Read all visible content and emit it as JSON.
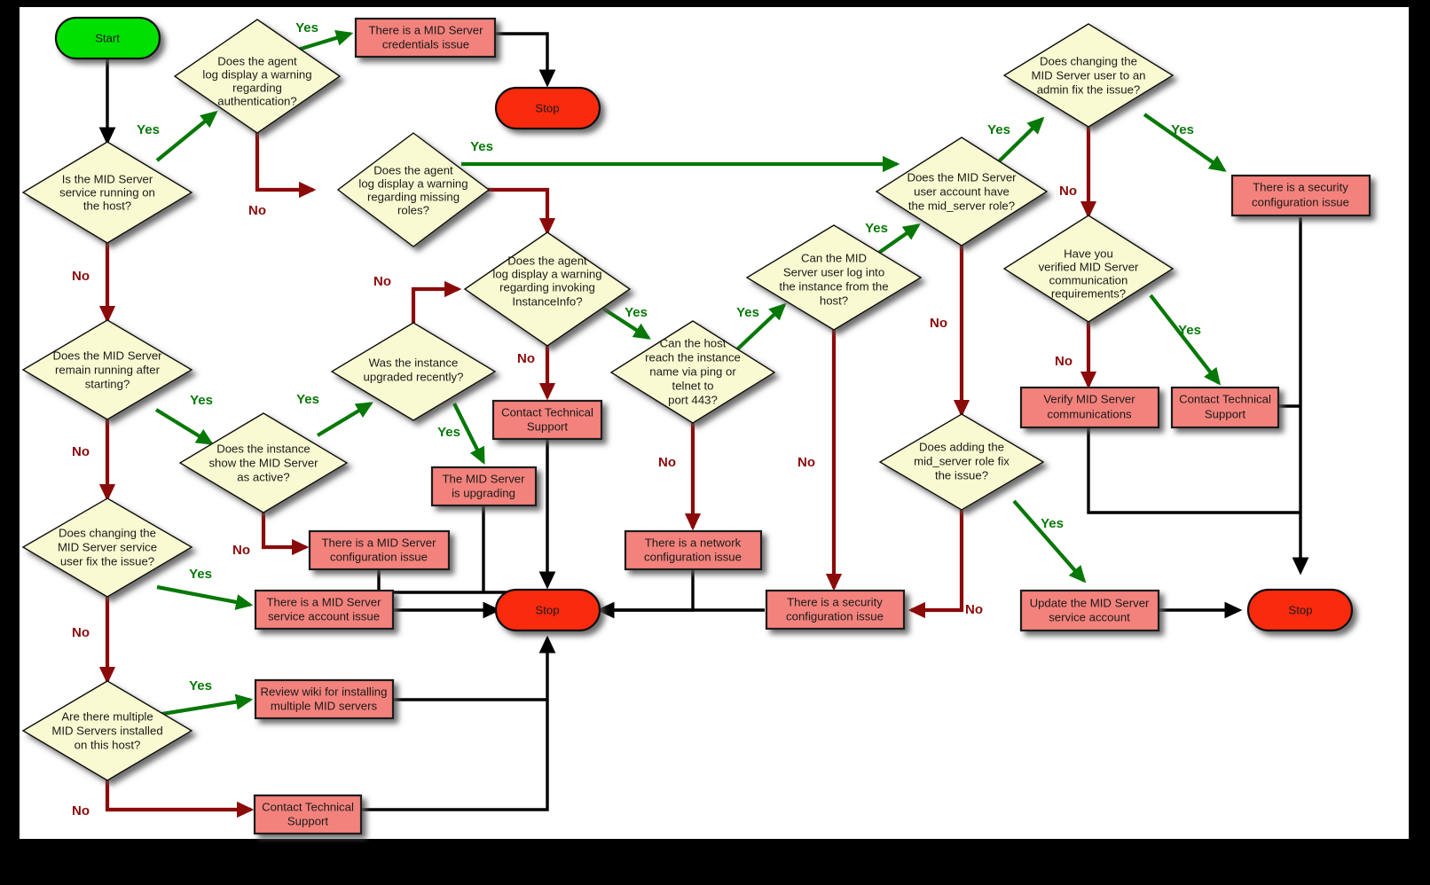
{
  "diagram": {
    "title": "MID Server troubleshooting flowchart",
    "colors": {
      "background": "#000000",
      "canvas": "#FFFFFF",
      "decision_fill": "#FAFAD2",
      "action_fill": "#F4827B",
      "start_fill": "#00E000",
      "stop_fill": "#FA2A0A",
      "yes_edge": "#067806",
      "no_edge": "#8B0A0A",
      "plain_edge": "#000000"
    }
  },
  "nodes": {
    "start": {
      "label": "Start",
      "type": "terminator"
    },
    "d_service_running": {
      "label": "Is the MID Server\nservice running on\nthe host?",
      "type": "decision"
    },
    "d_auth_warning": {
      "label": "Does the agent\nlog display a warning\nregarding\nauthentication?",
      "type": "decision"
    },
    "a_credentials_issue": {
      "label": "There is a MID Server\ncredentials issue",
      "type": "action"
    },
    "stop_top": {
      "label": "Stop",
      "type": "terminator"
    },
    "d_missing_roles": {
      "label": "Does the agent\nlog display a warning\nregarding missing\nroles?",
      "type": "decision"
    },
    "d_instanceinfo": {
      "label": "Does the agent\nlog display a warning\nregarding invoking\nInstanceInfo?",
      "type": "decision"
    },
    "d_remain_running": {
      "label": "Does the MID Server\nremain running after\nstarting?",
      "type": "decision"
    },
    "d_instance_active": {
      "label": "Does the instance\nshow the MID Server\nas active?",
      "type": "decision"
    },
    "d_upgraded_recently": {
      "label": "Was the instance\nupgraded recently?",
      "type": "decision"
    },
    "a_contact_support_mid": {
      "label": "Contact Technical\nSupport",
      "type": "action"
    },
    "a_mid_upgrading": {
      "label": "The MID Server\nis upgrading",
      "type": "action"
    },
    "a_mid_config_issue": {
      "label": "There is a MID Server\nconfiguration issue",
      "type": "action"
    },
    "d_change_service_user": {
      "label": "Does changing the\nMID Server service\nuser fix the issue?",
      "type": "decision"
    },
    "a_service_account_issue": {
      "label": "There is a MID Server\nservice account issue",
      "type": "action"
    },
    "d_multiple_mid": {
      "label": "Are there multiple\nMID Servers installed\non this host?",
      "type": "decision"
    },
    "a_review_wiki": {
      "label": "Review wiki for installing\nmultiple MID servers",
      "type": "action"
    },
    "a_contact_support_bottom": {
      "label": "Contact Technical\nSupport",
      "type": "action"
    },
    "stop_center": {
      "label": "Stop",
      "type": "terminator"
    },
    "d_host_reach": {
      "label": "Can the host\nreach the instance\nname via ping or\ntelnet to\nport 443?",
      "type": "decision"
    },
    "a_network_config_issue": {
      "label": "There is a network\nconfiguration issue",
      "type": "action"
    },
    "d_user_login": {
      "label": "Can the MID\nServer user log into\nthe instance from the\nhost?",
      "type": "decision"
    },
    "a_security_config_center": {
      "label": "There is a security\nconfiguration issue",
      "type": "action"
    },
    "d_mid_server_role": {
      "label": "Does the MID Server\nuser account have\nthe mid_server role?",
      "type": "decision"
    },
    "d_change_to_admin": {
      "label": "Does changing the\nMID Server user to an\nadmin fix the issue?",
      "type": "decision"
    },
    "a_security_config_right": {
      "label": "There is a security\nconfiguration issue",
      "type": "action"
    },
    "d_verified_comms": {
      "label": "Have you\nverified MID Server\ncommunication\nrequirements?",
      "type": "decision"
    },
    "a_verify_comms": {
      "label": "Verify MID Server\ncommunications",
      "type": "action"
    },
    "a_contact_support_right": {
      "label": "Contact Technical\nSupport",
      "type": "action"
    },
    "d_adding_role": {
      "label": "Does adding the\nmid_server role fix\nthe issue?",
      "type": "decision"
    },
    "a_update_service_account": {
      "label": "Update the MID Server\nservice account",
      "type": "action"
    },
    "stop_right": {
      "label": "Stop",
      "type": "terminator"
    }
  },
  "edge_labels": {
    "yes": "Yes",
    "no": "No"
  },
  "edges": [
    {
      "from": "start",
      "to": "d_service_running",
      "label": "",
      "kind": "plain"
    },
    {
      "from": "d_service_running",
      "to": "d_auth_warning",
      "label": "Yes",
      "kind": "yes"
    },
    {
      "from": "d_service_running",
      "to": "d_remain_running",
      "label": "No",
      "kind": "no"
    },
    {
      "from": "d_auth_warning",
      "to": "a_credentials_issue",
      "label": "Yes",
      "kind": "yes"
    },
    {
      "from": "d_auth_warning",
      "to": "d_missing_roles",
      "label": "No",
      "kind": "no"
    },
    {
      "from": "a_credentials_issue",
      "to": "stop_top",
      "label": "",
      "kind": "plain"
    },
    {
      "from": "d_missing_roles",
      "to": "d_mid_server_role",
      "label": "Yes",
      "kind": "yes"
    },
    {
      "from": "d_missing_roles",
      "to": "d_instanceinfo",
      "label": "No",
      "kind": "no"
    },
    {
      "from": "d_instanceinfo",
      "to": "d_host_reach",
      "label": "Yes",
      "kind": "yes"
    },
    {
      "from": "d_instanceinfo",
      "to": "a_contact_support_mid",
      "label": "No",
      "kind": "no"
    },
    {
      "from": "d_upgraded_recently",
      "to": "d_instanceinfo",
      "label": "No",
      "kind": "no"
    },
    {
      "from": "d_upgraded_recently",
      "to": "a_mid_upgrading",
      "label": "Yes",
      "kind": "yes"
    },
    {
      "from": "d_remain_running",
      "to": "d_instance_active",
      "label": "Yes",
      "kind": "yes"
    },
    {
      "from": "d_remain_running",
      "to": "d_change_service_user",
      "label": "No",
      "kind": "no"
    },
    {
      "from": "d_instance_active",
      "to": "d_upgraded_recently",
      "label": "Yes",
      "kind": "yes"
    },
    {
      "from": "d_instance_active",
      "to": "a_mid_config_issue",
      "label": "No",
      "kind": "no"
    },
    {
      "from": "d_change_service_user",
      "to": "a_service_account_issue",
      "label": "Yes",
      "kind": "yes"
    },
    {
      "from": "d_change_service_user",
      "to": "d_multiple_mid",
      "label": "No",
      "kind": "no"
    },
    {
      "from": "d_multiple_mid",
      "to": "a_review_wiki",
      "label": "Yes",
      "kind": "yes"
    },
    {
      "from": "d_multiple_mid",
      "to": "a_contact_support_bottom",
      "label": "No",
      "kind": "no"
    },
    {
      "from": "d_host_reach",
      "to": "d_user_login",
      "label": "Yes",
      "kind": "yes"
    },
    {
      "from": "d_host_reach",
      "to": "a_network_config_issue",
      "label": "No",
      "kind": "no"
    },
    {
      "from": "d_user_login",
      "to": "d_mid_server_role",
      "label": "Yes",
      "kind": "yes"
    },
    {
      "from": "d_user_login",
      "to": "a_security_config_center",
      "label": "No",
      "kind": "no"
    },
    {
      "from": "d_mid_server_role",
      "to": "d_change_to_admin",
      "label": "Yes",
      "kind": "yes"
    },
    {
      "from": "d_mid_server_role",
      "to": "d_adding_role",
      "label": "No",
      "kind": "no"
    },
    {
      "from": "d_change_to_admin",
      "to": "a_security_config_right",
      "label": "Yes",
      "kind": "yes"
    },
    {
      "from": "d_change_to_admin",
      "to": "d_verified_comms",
      "label": "No",
      "kind": "no"
    },
    {
      "from": "d_verified_comms",
      "to": "a_contact_support_right",
      "label": "Yes",
      "kind": "yes"
    },
    {
      "from": "d_verified_comms",
      "to": "a_verify_comms",
      "label": "No",
      "kind": "no"
    },
    {
      "from": "d_adding_role",
      "to": "a_update_service_account",
      "label": "Yes",
      "kind": "yes"
    },
    {
      "from": "d_adding_role",
      "to": "a_security_config_center",
      "label": "No",
      "kind": "no"
    },
    {
      "from": "a_mid_config_issue",
      "to": "stop_center",
      "label": "",
      "kind": "plain"
    },
    {
      "from": "a_mid_upgrading",
      "to": "stop_center",
      "label": "",
      "kind": "plain"
    },
    {
      "from": "a_contact_support_mid",
      "to": "stop_center",
      "label": "",
      "kind": "plain"
    },
    {
      "from": "a_service_account_issue",
      "to": "stop_center",
      "label": "",
      "kind": "plain"
    },
    {
      "from": "a_review_wiki",
      "to": "stop_center",
      "label": "",
      "kind": "plain"
    },
    {
      "from": "a_contact_support_bottom",
      "to": "stop_center",
      "label": "",
      "kind": "plain"
    },
    {
      "from": "a_network_config_issue",
      "to": "stop_center",
      "label": "",
      "kind": "plain"
    },
    {
      "from": "a_security_config_center",
      "to": "stop_center",
      "label": "",
      "kind": "plain"
    },
    {
      "from": "a_update_service_account",
      "to": "stop_right",
      "label": "",
      "kind": "plain"
    },
    {
      "from": "a_security_config_right",
      "to": "stop_right",
      "label": "",
      "kind": "plain"
    },
    {
      "from": "a_contact_support_right",
      "to": "stop_right",
      "label": "",
      "kind": "plain"
    },
    {
      "from": "a_verify_comms",
      "to": "stop_right",
      "label": "",
      "kind": "plain"
    }
  ]
}
